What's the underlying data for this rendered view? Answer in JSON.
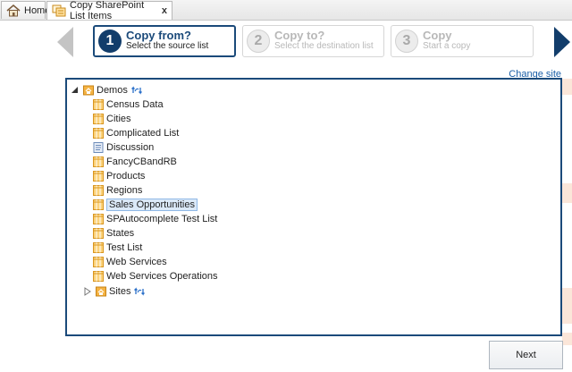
{
  "tabs": [
    {
      "label": "Home",
      "icon": "home-icon"
    },
    {
      "label": "Copy SharePoint List Items",
      "icon": "copy-list-icon",
      "close": "x"
    }
  ],
  "wizard": {
    "steps": [
      {
        "number": "1",
        "title": "Copy from?",
        "subtitle": "Select the source list",
        "state": "active"
      },
      {
        "number": "2",
        "title": "Copy to?",
        "subtitle": "Select the destination list",
        "state": "inactive"
      },
      {
        "number": "3",
        "title": "Copy",
        "subtitle": "Start a copy",
        "state": "inactive"
      }
    ],
    "accent_color": "#1b4a7a"
  },
  "change_site": "Change site",
  "tree": {
    "root": {
      "label": "Demos",
      "icon": "site-icon",
      "expanded": true
    },
    "lists": [
      {
        "label": "Census Data",
        "icon": "list-icon"
      },
      {
        "label": "Cities",
        "icon": "list-icon"
      },
      {
        "label": "Complicated List",
        "icon": "list-icon"
      },
      {
        "label": "Discussion",
        "icon": "discussion-icon"
      },
      {
        "label": "FancyCBandRB",
        "icon": "list-icon"
      },
      {
        "label": "Products",
        "icon": "list-icon"
      },
      {
        "label": "Regions",
        "icon": "list-icon"
      },
      {
        "label": "Sales Opportunities",
        "icon": "list-icon",
        "selected": true
      },
      {
        "label": "SPAutocomplete Test List",
        "icon": "list-icon"
      },
      {
        "label": "States",
        "icon": "list-icon"
      },
      {
        "label": "Test List",
        "icon": "list-icon"
      },
      {
        "label": "Web Services",
        "icon": "list-icon"
      },
      {
        "label": "Web Services Operations",
        "icon": "list-icon"
      }
    ],
    "sites": {
      "label": "Sites",
      "icon": "site-icon",
      "expanded": false
    }
  },
  "buttons": {
    "next": "Next"
  }
}
